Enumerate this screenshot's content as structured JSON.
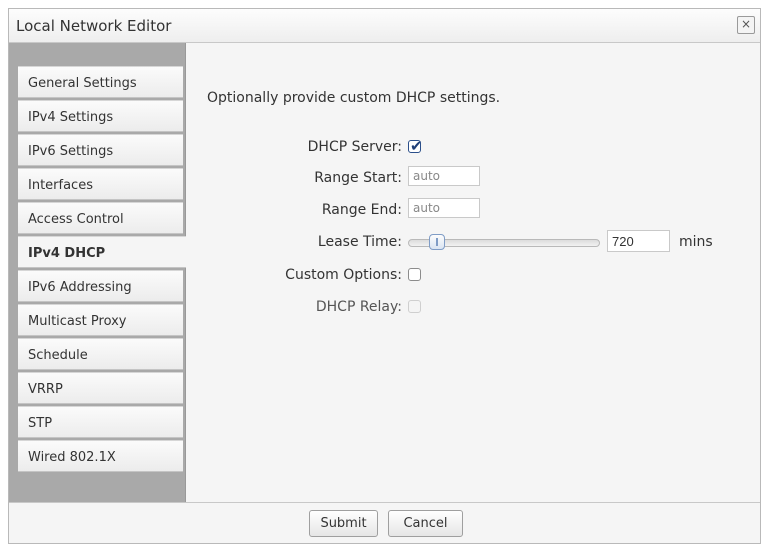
{
  "window": {
    "title": "Local Network Editor",
    "close_glyph": "×"
  },
  "sidebar": {
    "items": [
      {
        "label": "General Settings"
      },
      {
        "label": "IPv4 Settings"
      },
      {
        "label": "IPv6 Settings"
      },
      {
        "label": "Interfaces"
      },
      {
        "label": "Access Control"
      },
      {
        "label": "IPv4 DHCP",
        "active": true
      },
      {
        "label": "IPv6 Addressing"
      },
      {
        "label": "Multicast Proxy"
      },
      {
        "label": "Schedule"
      },
      {
        "label": "VRRP"
      },
      {
        "label": "STP"
      },
      {
        "label": "Wired 802.1X"
      }
    ]
  },
  "main": {
    "intro": "Optionally provide custom DHCP settings.",
    "dhcp_server": {
      "label": "DHCP Server:",
      "checked": true
    },
    "range_start": {
      "label": "Range Start:",
      "value": "auto"
    },
    "range_end": {
      "label": "Range End:",
      "value": "auto"
    },
    "lease_time": {
      "label": "Lease Time:",
      "value": "720",
      "unit": "mins",
      "slider_level": 0.12
    },
    "custom_options": {
      "label": "Custom Options:",
      "checked": false
    },
    "dhcp_relay": {
      "label": "DHCP Relay:",
      "checked": false,
      "disabled": true
    }
  },
  "footer": {
    "submit_label": "Submit",
    "cancel_label": "Cancel"
  },
  "colors": {
    "sidebar_bg": "#a9a9a9",
    "check_accent": "#1f3f78",
    "slider_accent": "#7f9cc6"
  },
  "icons": {
    "close": "close-icon",
    "check": "checkmark-icon"
  }
}
